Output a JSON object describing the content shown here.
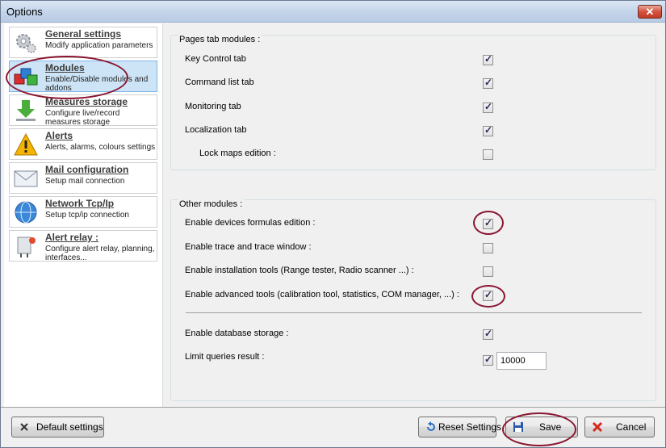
{
  "window": {
    "title": "Options",
    "close_label": "✕"
  },
  "sidebar": {
    "items": [
      {
        "title": "General settings",
        "desc": "Modify application parameters",
        "icon": "gears-icon"
      },
      {
        "title": "Modules",
        "desc": "Enable/Disable modules and addons",
        "icon": "modules-icon"
      },
      {
        "title": "Measures storage",
        "desc": "Configure live/record measures storage",
        "icon": "download-icon"
      },
      {
        "title": "Alerts",
        "desc": "Alerts, alarms, colours settings",
        "icon": "warning-icon"
      },
      {
        "title": "Mail configuration",
        "desc": "Setup mail connection",
        "icon": "mail-icon"
      },
      {
        "title": "Network Tcp/Ip",
        "desc": "Setup tcp/ip connection",
        "icon": "globe-icon"
      },
      {
        "title": "Alert relay :",
        "desc": "Configure alert relay, planning, interfaces...",
        "icon": "relay-icon"
      }
    ]
  },
  "pages_tab": {
    "title": "Pages tab modules :",
    "rows": [
      {
        "label": "Key Control tab",
        "checked": true
      },
      {
        "label": "Command list tab",
        "checked": true
      },
      {
        "label": "Monitoring tab",
        "checked": true
      },
      {
        "label": "Localization tab",
        "checked": true
      },
      {
        "label": "Lock maps edition :",
        "checked": false
      }
    ]
  },
  "other_modules": {
    "title": "Other modules :",
    "rows": [
      {
        "label": "Enable devices formulas edition :",
        "checked": true
      },
      {
        "label": "Enable trace and trace window :",
        "checked": false
      },
      {
        "label": "Enable installation tools (Range tester, Radio scanner ...) :",
        "checked": false
      },
      {
        "label": "Enable advanced tools (calibration tool, statistics, COM manager, ...) :",
        "checked": true
      },
      {
        "label": "Enable database storage :",
        "checked": true
      },
      {
        "label": "Limit queries result :",
        "checked": true
      }
    ],
    "limit_value": "10000"
  },
  "footer": {
    "default_label": "Default settings",
    "reset_label": "Reset Settings",
    "save_label": "Save",
    "cancel_label": "Cancel"
  },
  "colors": {
    "accent": "#cde4f7",
    "annotation": "#8a1530"
  }
}
